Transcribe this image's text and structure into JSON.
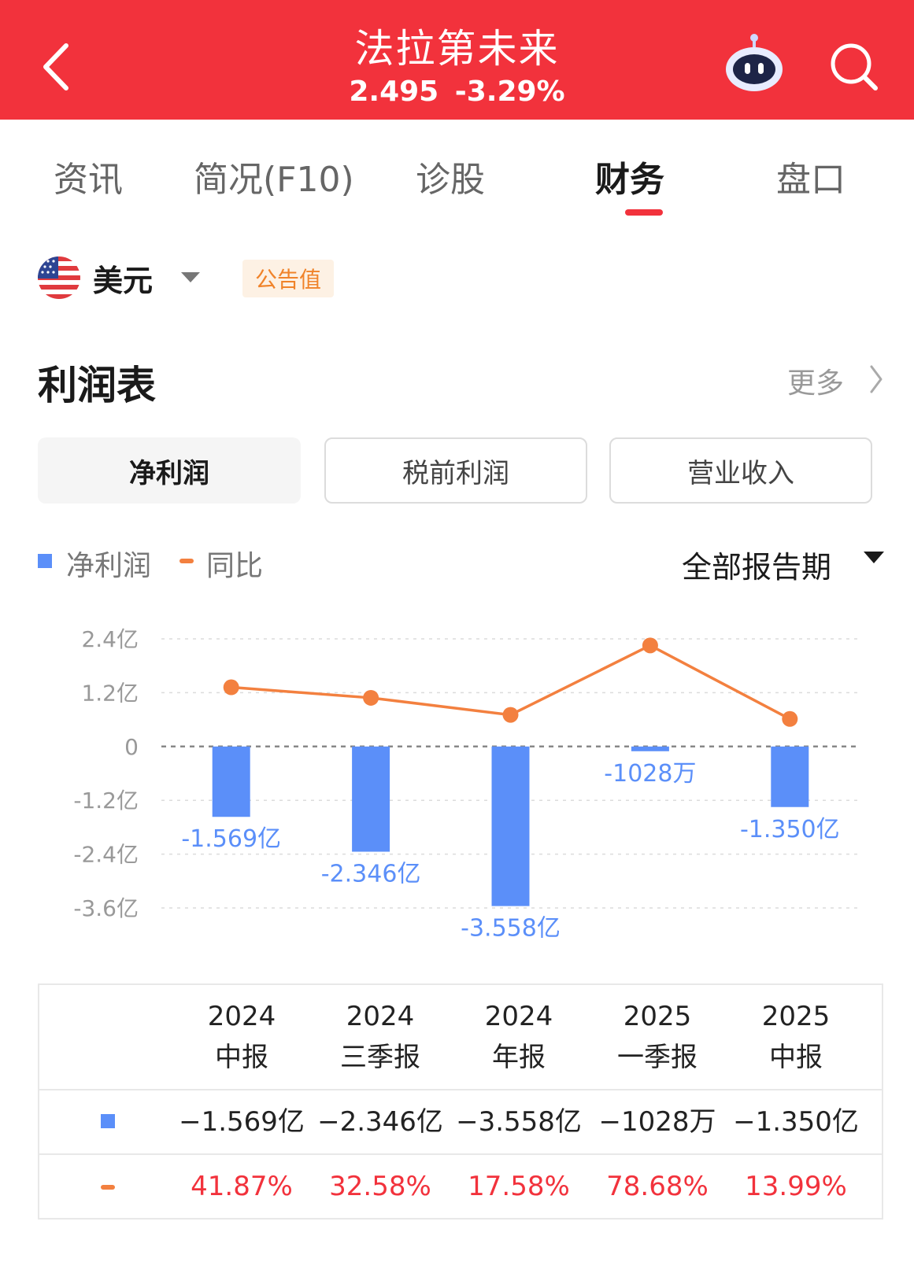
{
  "header": {
    "title": "法拉第未来",
    "price": "2.495",
    "change": "-3.29%"
  },
  "tabs": [
    "资讯",
    "简况(F10)",
    "诊股",
    "财务",
    "盘口"
  ],
  "active_tab": "财务",
  "currency": {
    "label": "美元",
    "badge": "公告值"
  },
  "section": {
    "title": "利润表",
    "more": "更多"
  },
  "segments": [
    "净利润",
    "税前利润",
    "营业收入"
  ],
  "legend": {
    "bar": "净利润",
    "line": "同比"
  },
  "period_selector": "全部报告期",
  "chart_data": {
    "type": "bar",
    "categories": [
      "2024中报",
      "2024三季报",
      "2024年报",
      "2025一季报",
      "2025中报"
    ],
    "y_ticks": [
      "2.4亿",
      "1.2亿",
      "0",
      "-1.2亿",
      "-2.4亿",
      "-3.6亿"
    ],
    "ylim": [
      -3.6,
      2.4
    ],
    "series": [
      {
        "name": "净利润",
        "type": "bar",
        "unit": "亿",
        "values": [
          -1.569,
          -2.346,
          -3.558,
          -0.1028,
          -1.35
        ],
        "labels": [
          "-1.569亿",
          "-2.346亿",
          "-3.558亿",
          "-1028万",
          "-1.350亿"
        ],
        "color": "#5b8ff9"
      },
      {
        "name": "同比",
        "type": "line",
        "unit": "%",
        "values": [
          41.87,
          32.58,
          17.58,
          78.68,
          13.99
        ],
        "color": "#f3803f"
      }
    ]
  },
  "table": {
    "columns": [
      {
        "year": "2024",
        "period": "中报"
      },
      {
        "year": "2024",
        "period": "三季报"
      },
      {
        "year": "2024",
        "period": "年报"
      },
      {
        "year": "2025",
        "period": "一季报"
      },
      {
        "year": "2025",
        "period": "中报"
      }
    ],
    "net_profit": [
      "−1.569亿",
      "−2.346亿",
      "−3.558亿",
      "−1028万",
      "−1.350亿"
    ],
    "yoy": [
      "41.87%",
      "32.58%",
      "17.58%",
      "78.68%",
      "13.99%"
    ]
  }
}
